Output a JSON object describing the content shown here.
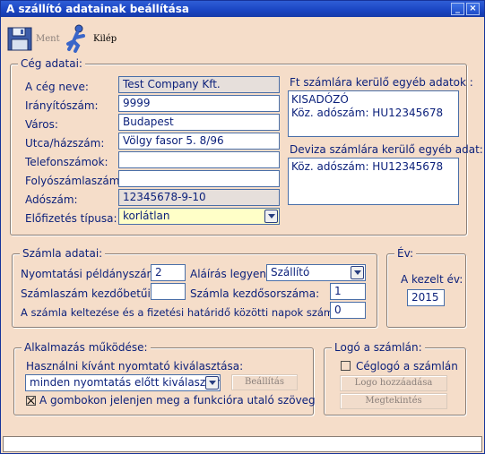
{
  "window": {
    "title": "A szállító adatainak beállítása",
    "minimize_glyph": "_",
    "close_glyph": "×"
  },
  "toolbar": {
    "save_label": "Ment",
    "save_icon": "floppy-disk-icon",
    "exit_label": "Kilép",
    "exit_icon": "running-man-icon"
  },
  "company": {
    "legend": "Cég adatai:",
    "name_label": "A cég neve:",
    "name_value": "Test Company Kft.",
    "zip_label": "Irányítószám:",
    "zip_value": "9999",
    "city_label": "Város:",
    "city_value": "Budapest",
    "street_label": "Utca/házszám:",
    "street_value": "Völgy fasor 5. 8/96",
    "phone_label": "Telefonszámok:",
    "phone_value": "",
    "account_label": "Folyószámlaszám:",
    "account_value": "",
    "tax_label": "Adószám:",
    "tax_value": "12345678-9-10",
    "subscription_label": "Előfizetés típusa:",
    "subscription_value": "korlátlan",
    "ft_other_label": "Ft számlára kerülő egyéb adatok :",
    "ft_other_lines": [
      "KISADÓZÓ",
      "Köz. adószám: HU12345678"
    ],
    "fx_other_label": "Deviza számlára kerülő egyéb adat:",
    "fx_other_lines": [
      "Köz. adószám: HU12345678"
    ]
  },
  "invoice": {
    "legend": "Számla adatai:",
    "copies_label": "Nyomtatási példányszám:",
    "copies_value": "2",
    "signature_label": "Aláírás legyen:",
    "signature_value": "Szállító",
    "prefix_label": "Számlaszám kezdőbetűi:",
    "prefix_value": "",
    "start_label": "Számla kezdősorszáma:",
    "start_value": "1",
    "days_label": "A számla keltezése és a fizetési határidő közötti napok száma:",
    "days_value": "0"
  },
  "year": {
    "legend": "Év:",
    "label": "A kezelt év:",
    "value": "2015"
  },
  "app": {
    "legend": "Alkalmazás működése:",
    "printer_label": "Használni kívánt nyomtató kiválasztása:",
    "printer_value": "minden nyomtatás előtt kiválasztom",
    "settings_button": "Beállítás",
    "show_text_label": "A gombokon jelenjen meg a funkcióra utaló szöveg",
    "show_text_checked": true
  },
  "logo": {
    "legend": "Logó a számlán:",
    "company_logo_label": "Céglogó a számlán",
    "company_logo_checked": false,
    "add_button": "Logo hozzáadása",
    "preview_button": "Megtekintés"
  },
  "status": {
    "text": ""
  }
}
